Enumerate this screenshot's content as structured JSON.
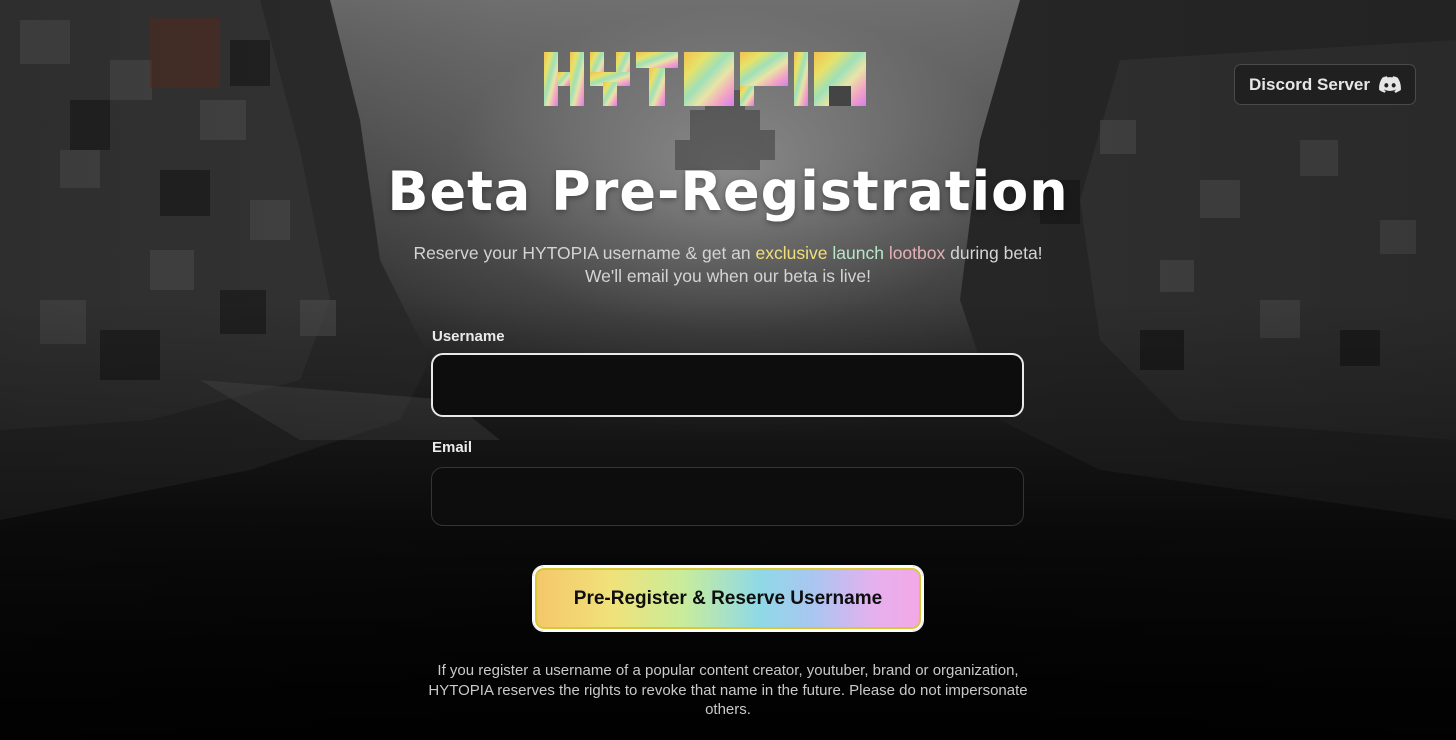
{
  "brand": {
    "logo_text": "HYTOPIA"
  },
  "header": {
    "discord_label": "Discord Server"
  },
  "hero": {
    "title": "Beta Pre-Registration",
    "subtitle_part1": "Reserve your HYTOPIA username & get an ",
    "subtitle_exclusive": "exclusive",
    "subtitle_launch": "launch",
    "subtitle_lootbox": "lootbox",
    "subtitle_part2": " during beta!",
    "subtitle_line2": "We'll email you when our beta is live!"
  },
  "form": {
    "username_label": "Username",
    "username_value": "",
    "email_label": "Email",
    "email_value": "",
    "submit_label": "Pre-Register & Reserve Username"
  },
  "footer": {
    "disclaimer": "If you register a username of a popular content creator, youtuber, brand or organization, HYTOPIA reserves the rights to revoke that name in the future. Please do not impersonate others."
  },
  "colors": {
    "highlight_exclusive": "#f1e07a",
    "highlight_launch": "#b9e6c8",
    "highlight_lootbox": "#e3b2b6",
    "cta_gradient_start": "#f5c66a",
    "cta_gradient_end": "#f3a8e6"
  }
}
